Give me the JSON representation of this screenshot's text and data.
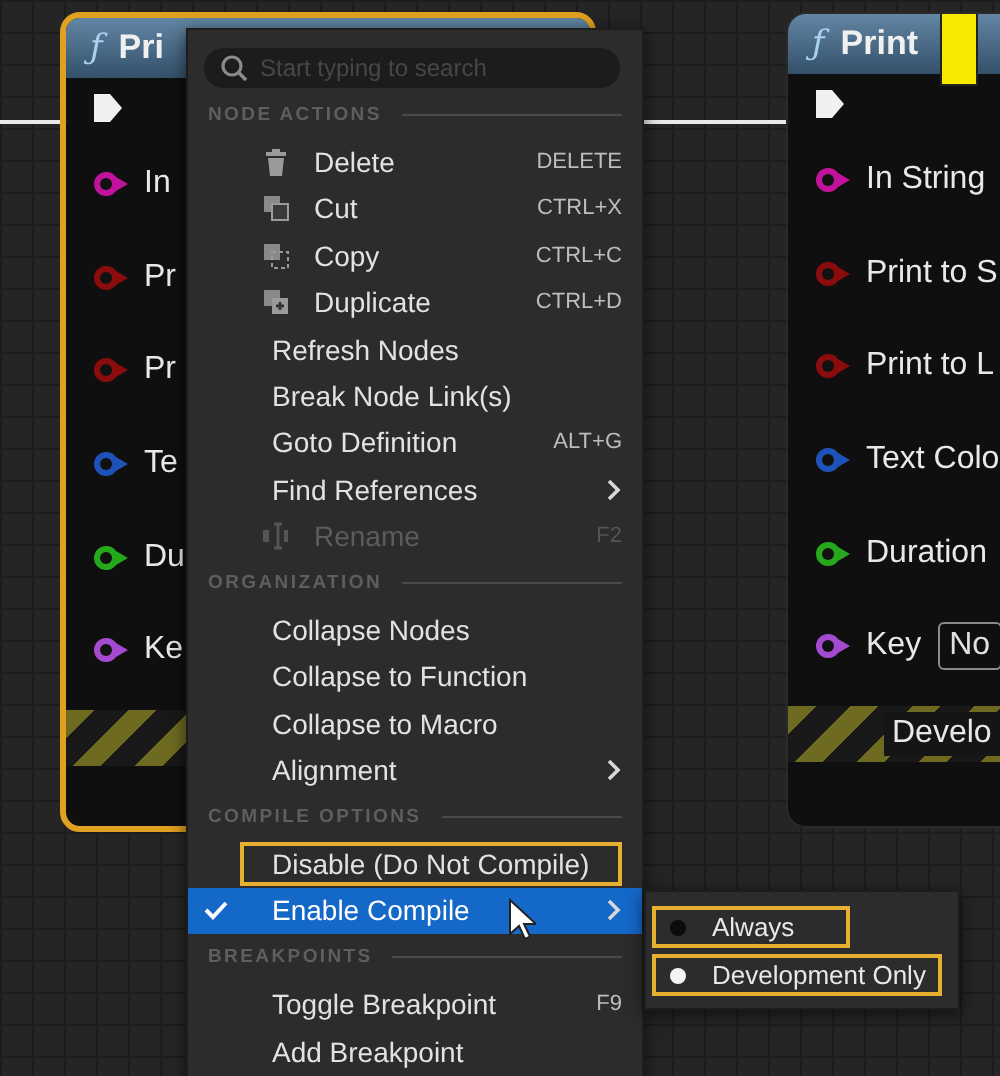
{
  "graph": {
    "nodes": [
      {
        "title": "Pri",
        "function_mark": "ƒ",
        "selected": true,
        "pins": [
          {
            "label": "In",
            "color": "#c0129a"
          },
          {
            "label": "Pr",
            "color": "#8a0c0c"
          },
          {
            "label": "Pr",
            "color": "#8a0c0c"
          },
          {
            "label": "Te",
            "color": "#1f52b8"
          },
          {
            "label": "Du",
            "color": "#25a81c"
          },
          {
            "label": "Ke",
            "color": "#a44ad0"
          }
        ]
      },
      {
        "title": "Print",
        "function_mark": "ƒ",
        "selected": false,
        "marker": true,
        "pins": [
          {
            "label": "In String",
            "color": "#c0129a"
          },
          {
            "label": "Print to S",
            "color": "#8a0c0c"
          },
          {
            "label": "Print to L",
            "color": "#8a0c0c"
          },
          {
            "label": "Text Colo",
            "color": "#1f52b8"
          },
          {
            "label": "Duration",
            "color": "#25a81c"
          },
          {
            "label": "Key",
            "color": "#a44ad0",
            "field": "No"
          }
        ],
        "footer": "Develo"
      }
    ]
  },
  "context_menu": {
    "search": {
      "placeholder": "Start typing to search"
    },
    "sections": [
      {
        "heading": "NODE ACTIONS",
        "items": [
          {
            "label": "Delete",
            "kind": "with-icon",
            "shortcut": "DELETE",
            "disabled": false,
            "selected": false
          },
          {
            "label": "Cut",
            "kind": "with-icon",
            "shortcut": "CTRL+X",
            "disabled": false,
            "selected": false
          },
          {
            "label": "Copy",
            "kind": "with-icon",
            "shortcut": "CTRL+C",
            "disabled": false,
            "selected": false
          },
          {
            "label": "Duplicate",
            "kind": "with-icon",
            "shortcut": "CTRL+D",
            "disabled": false,
            "selected": false
          },
          {
            "label": "Refresh Nodes",
            "disabled": false,
            "selected": false
          },
          {
            "label": "Break Node Link(s)",
            "disabled": false,
            "selected": false
          },
          {
            "label": "Goto Definition",
            "shortcut": "ALT+G",
            "disabled": false,
            "selected": false
          },
          {
            "label": "Find References",
            "submenu": true,
            "disabled": false,
            "selected": false
          },
          {
            "label": "Rename",
            "kind": "with-icon",
            "shortcut": "F2",
            "disabled": true,
            "selected": false
          }
        ]
      },
      {
        "heading": "ORGANIZATION",
        "items": [
          {
            "label": "Collapse Nodes",
            "selected": false
          },
          {
            "label": "Collapse to Function",
            "selected": false
          },
          {
            "label": "Collapse to Macro",
            "selected": false
          },
          {
            "label": "Alignment",
            "submenu": true,
            "selected": false
          }
        ]
      },
      {
        "heading": "COMPILE OPTIONS",
        "items": [
          {
            "label": "Disable (Do Not Compile)",
            "checked": false,
            "selected": false,
            "highlighted": true
          },
          {
            "label": "Enable Compile",
            "checked": true,
            "selected": true,
            "submenu": true,
            "highlighted": false
          }
        ]
      },
      {
        "heading": "BREAKPOINTS",
        "items": [
          {
            "label": "Toggle Breakpoint",
            "shortcut": "F9",
            "selected": false
          },
          {
            "label": "Add Breakpoint",
            "selected": false
          }
        ]
      }
    ]
  },
  "submenu": {
    "items": [
      {
        "label": "Always",
        "selected": false,
        "highlighted": true
      },
      {
        "label": "Development Only",
        "selected": true,
        "highlighted": true
      }
    ]
  }
}
